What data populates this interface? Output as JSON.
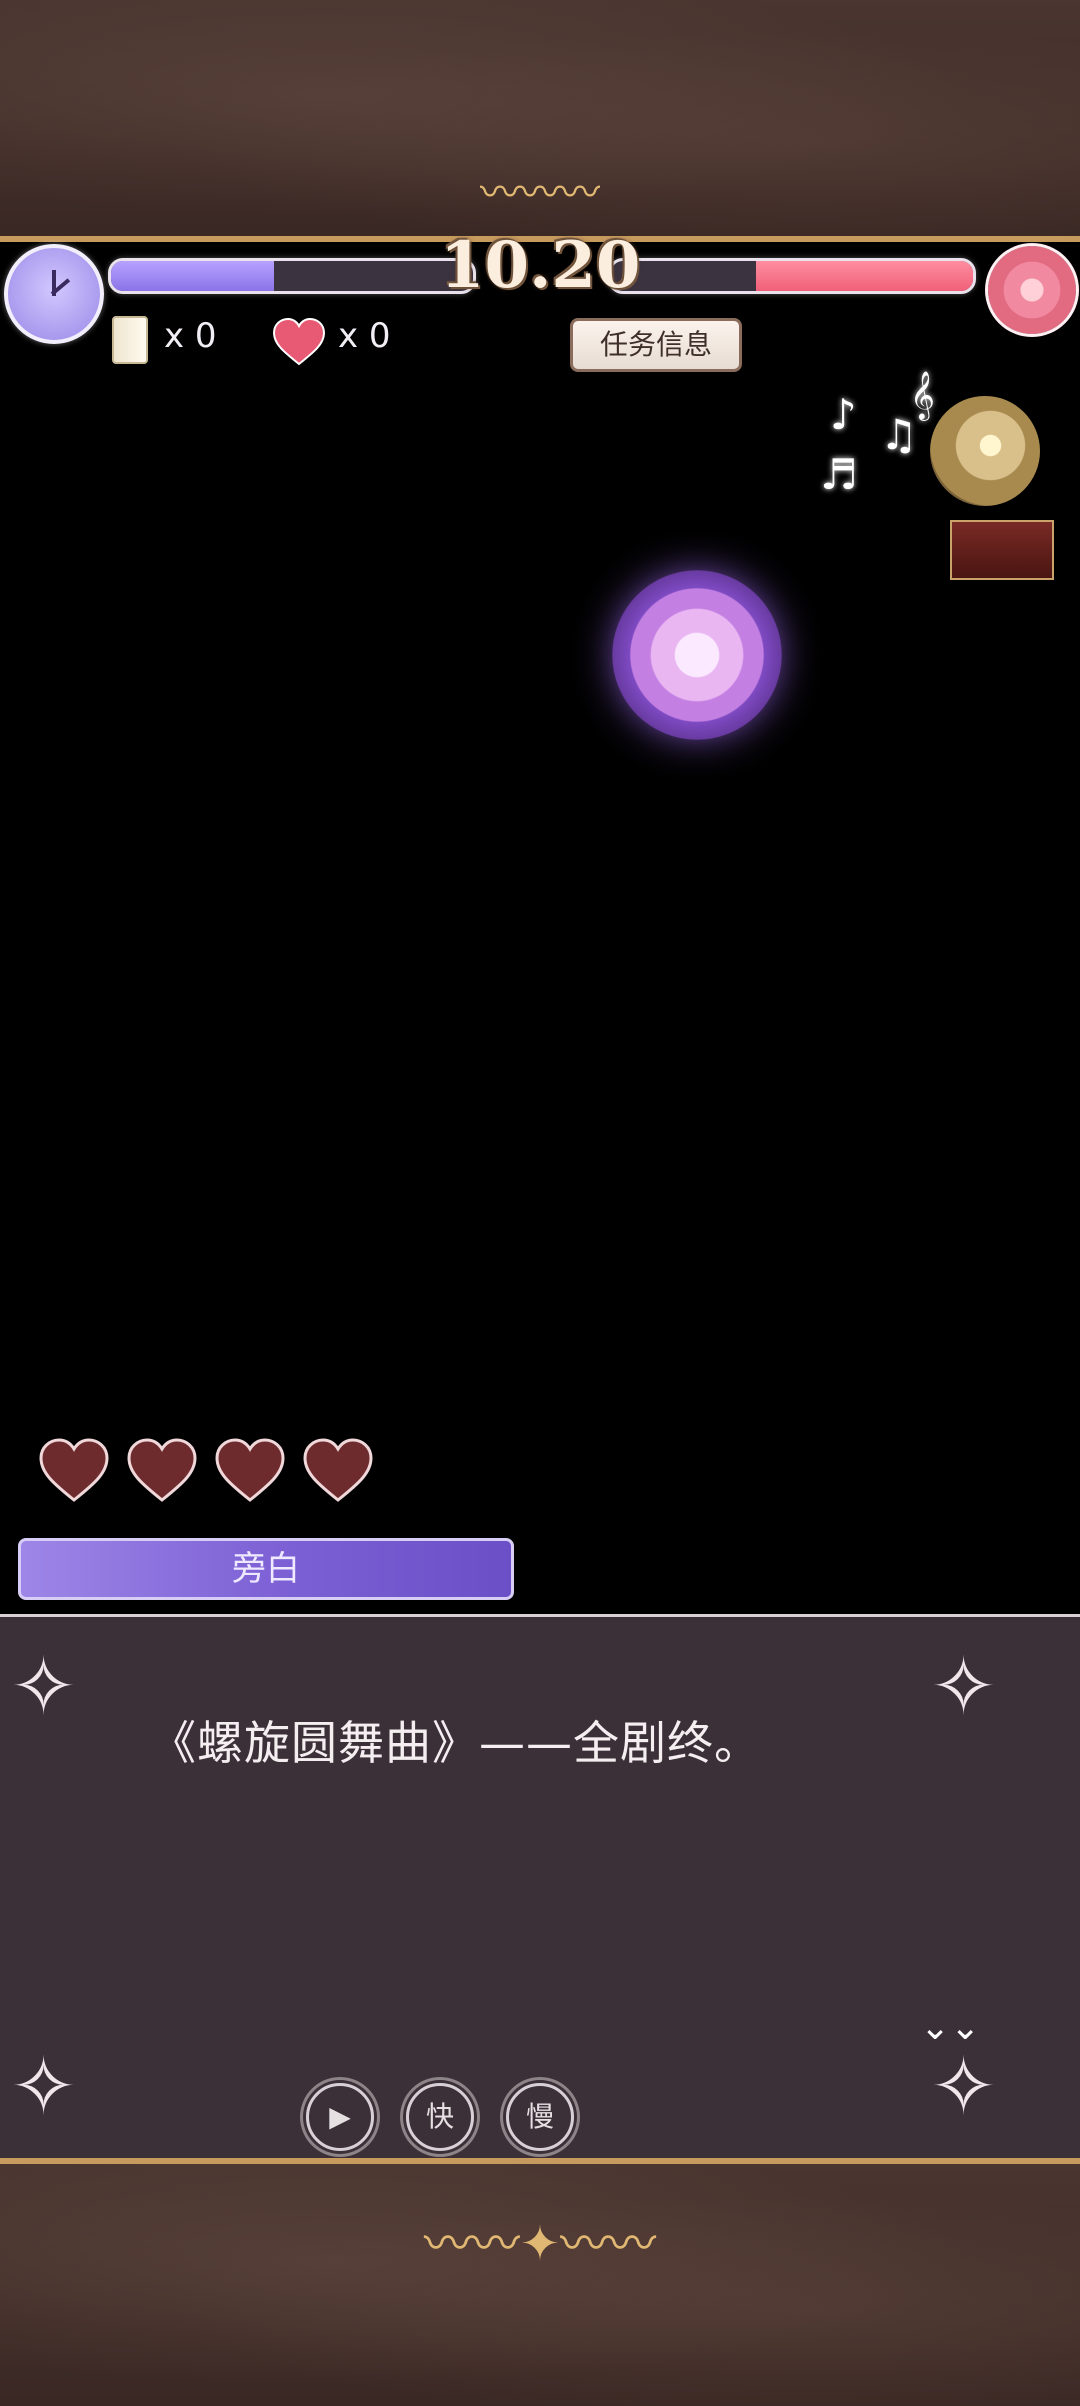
{
  "hud": {
    "timer": "10.20",
    "scroll_count": "x 0",
    "heart_count": "x 0",
    "mission_button": "任务信息"
  },
  "speaker_name": "旁白",
  "dialog_text": "《螺旋圆舞曲》——全剧终。",
  "controls": {
    "auto_label": "▶",
    "fast_label": "快",
    "slow_label": "慢",
    "next_label": "⌄⌄"
  },
  "colors": {
    "left_bar": "#8a73e8",
    "right_bar": "#f06078",
    "dialog_bg": "#3b3037",
    "frame_border": "#c79a5e"
  }
}
